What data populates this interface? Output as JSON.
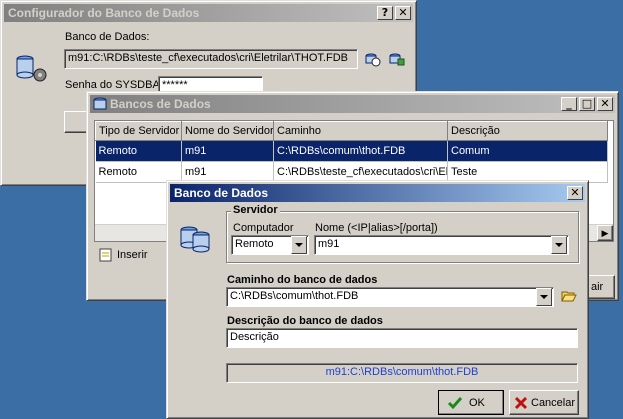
{
  "config": {
    "title": "Configurador do Banco de Dados",
    "db_label": "Banco de Dados:",
    "db_value": "m91:C:\\RDBs\\teste_cf\\executados\\cri\\Eletrilar\\THOT.FDB",
    "password_label": "Senha do SYSDBA:",
    "password_value": "******"
  },
  "list": {
    "title": "Bancos de Dados",
    "columns": [
      "Tipo de Servidor",
      "Nome do Servidor",
      "Caminho",
      "Descrição"
    ],
    "rows": [
      [
        "Remoto",
        "m91",
        "C:\\RDBs\\comum\\thot.FDB",
        "Comum"
      ],
      [
        "Remoto",
        "m91",
        "C:\\RDBs\\teste_cf\\executados\\cri\\El",
        "Teste"
      ]
    ],
    "insert_label": "Inserir",
    "close_label_fragment": "air"
  },
  "dialog": {
    "title": "Banco de Dados",
    "server_group": "Servidor",
    "computer_label": "Computador",
    "computer_value": "Remoto",
    "name_label": "Nome (<IP|alias>[/porta])",
    "name_value": "m91",
    "path_label": "Caminho do banco de dados",
    "path_value": "C:\\RDBs\\comum\\thot.FDB",
    "desc_label": "Descrição do banco de dados",
    "desc_value": "Descrição",
    "summary": "m91:C:\\RDBs\\comum\\thot.FDB",
    "ok_label": "OK",
    "cancel_label": "Cancelar"
  },
  "colors": {
    "desktop": "#3a6ea5",
    "selection": "#0a246a",
    "summary_text": "#1f3fd0"
  }
}
